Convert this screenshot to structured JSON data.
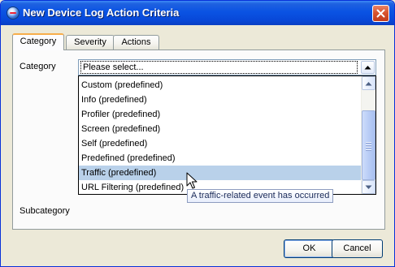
{
  "window": {
    "title": "New Device Log Action Criteria"
  },
  "tabs": [
    {
      "label": "Category",
      "active": true
    },
    {
      "label": "Severity",
      "active": false
    },
    {
      "label": "Actions",
      "active": false
    }
  ],
  "form": {
    "category_label": "Category",
    "subcategory_label": "Subcategory",
    "category_value": "Please select..."
  },
  "dropdown": {
    "items": [
      "Custom (predefined)",
      "Info (predefined)",
      "Profiler (predefined)",
      "Screen (predefined)",
      "Self (predefined)",
      "Predefined (predefined)",
      "Traffic (predefined)",
      "URL Filtering (predefined)"
    ],
    "hovered_index": 6
  },
  "tooltip": {
    "text": "A traffic-related event has occurred"
  },
  "buttons": {
    "ok": "OK",
    "cancel": "Cancel"
  },
  "colors": {
    "titlebar": "#0a53e3",
    "hover_row": "#b9d1ea",
    "active_tab_accent": "#f7ad4a"
  }
}
